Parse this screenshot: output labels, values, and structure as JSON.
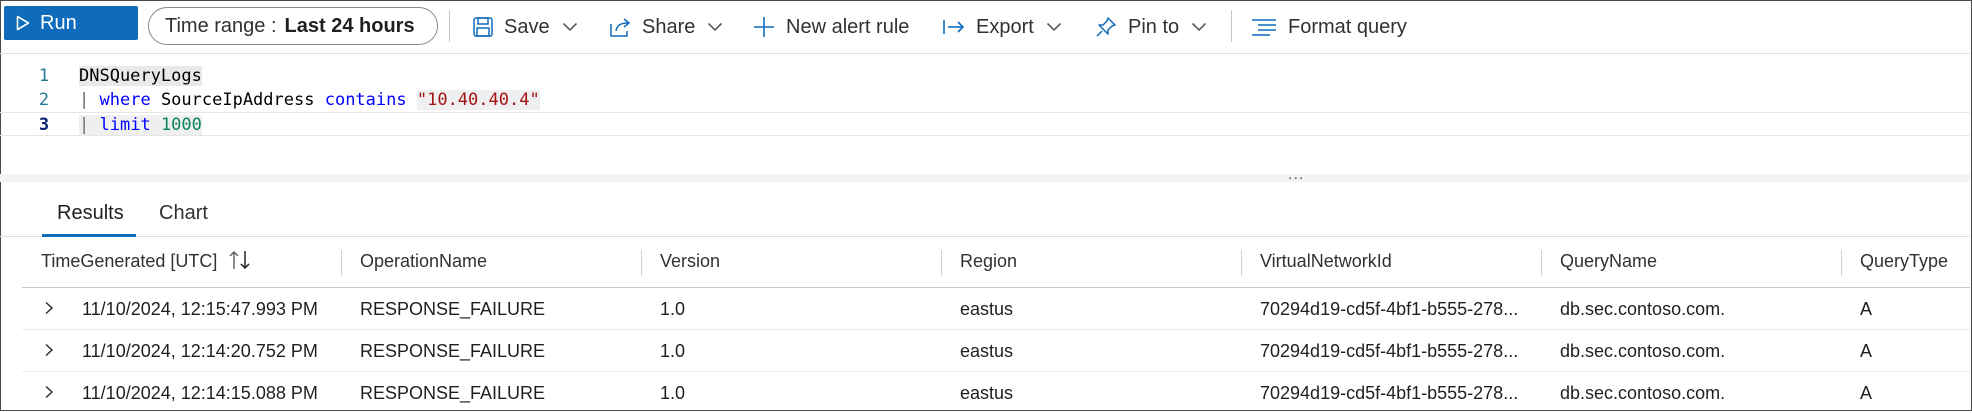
{
  "toolbar": {
    "run_label": "Run",
    "time_range_label": "Time range :",
    "time_range_value": "Last 24 hours",
    "save_label": "Save",
    "share_label": "Share",
    "new_alert_label": "New alert rule",
    "export_label": "Export",
    "pin_label": "Pin to",
    "format_label": "Format query"
  },
  "editor": {
    "lines": [
      {
        "num": "1",
        "tokens": [
          "DNSQueryLogs"
        ]
      },
      {
        "num": "2",
        "tokens": [
          "|",
          "where",
          "SourceIpAddress",
          "contains",
          "\"10.40.40.4\""
        ]
      },
      {
        "num": "3",
        "tokens": [
          "|",
          "limit",
          "1000"
        ]
      }
    ],
    "resizer_dots": "..."
  },
  "tabs": {
    "results": "Results",
    "chart": "Chart"
  },
  "grid": {
    "columns": [
      "TimeGenerated [UTC]",
      "OperationName",
      "Version",
      "Region",
      "VirtualNetworkId",
      "QueryName",
      "QueryType"
    ],
    "rows": [
      [
        "11/10/2024, 12:15:47.993 PM",
        "RESPONSE_FAILURE",
        "1.0",
        "eastus",
        "70294d19-cd5f-4bf1-b555-278...",
        "db.sec.contoso.com.",
        "A"
      ],
      [
        "11/10/2024, 12:14:20.752 PM",
        "RESPONSE_FAILURE",
        "1.0",
        "eastus",
        "70294d19-cd5f-4bf1-b555-278...",
        "db.sec.contoso.com.",
        "A"
      ],
      [
        "11/10/2024, 12:14:15.088 PM",
        "RESPONSE_FAILURE",
        "1.0",
        "eastus",
        "70294d19-cd5f-4bf1-b555-278...",
        "db.sec.contoso.com.",
        "A"
      ]
    ]
  },
  "colors": {
    "accent": "#0f6cbd",
    "keyword": "#0000ff",
    "string": "#a31515",
    "number": "#098658"
  },
  "icons": [
    "play-icon",
    "save-icon",
    "share-icon",
    "plus-icon",
    "export-icon",
    "pin-icon",
    "format-icon",
    "chevron-down-icon",
    "sort-icon",
    "chevron-right-icon"
  ]
}
